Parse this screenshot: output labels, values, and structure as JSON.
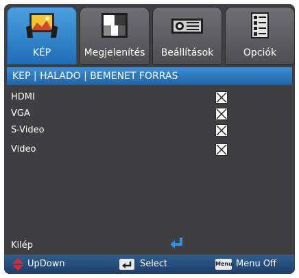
{
  "tabs": [
    {
      "label": "KÉP",
      "icon": "image-icon",
      "active": true
    },
    {
      "label": "Megjelenítés",
      "icon": "display-pattern-icon"
    },
    {
      "label": "Beállítások",
      "icon": "projector-icon"
    },
    {
      "label": "Opciók",
      "icon": "options-list-icon"
    }
  ],
  "header": {
    "breadcrumb": "KEP | HALADO | BEMENET FORRAS"
  },
  "options": [
    {
      "label": "HDMI",
      "checked": true
    },
    {
      "label": "VGA",
      "checked": true
    },
    {
      "label": "S-Video",
      "checked": true
    },
    {
      "label": "Video",
      "checked": true
    }
  ],
  "exit": {
    "label": "Kilép"
  },
  "footer": {
    "updown": "UpDown",
    "select": "Select",
    "menu_key": "Menu",
    "menu_off": "Menu Off"
  },
  "colors": {
    "accent": "#2a7ac8",
    "panel": "#3f3f41",
    "footer": "#23466e",
    "updown": "#e0262a"
  }
}
